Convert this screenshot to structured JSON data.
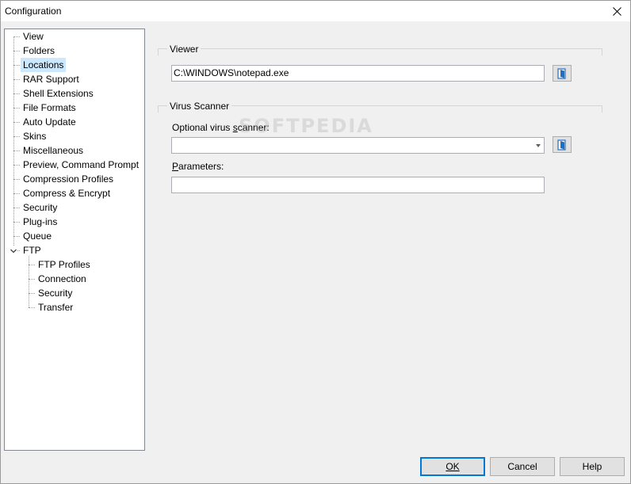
{
  "window": {
    "title": "Configuration"
  },
  "tree": {
    "items": [
      {
        "label": "View",
        "level": 0
      },
      {
        "label": "Folders",
        "level": 0
      },
      {
        "label": "Locations",
        "level": 0,
        "selected": true
      },
      {
        "label": "RAR Support",
        "level": 0
      },
      {
        "label": "Shell Extensions",
        "level": 0
      },
      {
        "label": "File Formats",
        "level": 0
      },
      {
        "label": "Auto Update",
        "level": 0
      },
      {
        "label": "Skins",
        "level": 0
      },
      {
        "label": "Miscellaneous",
        "level": 0
      },
      {
        "label": "Preview, Command Prompt",
        "level": 0
      },
      {
        "label": "Compression Profiles",
        "level": 0
      },
      {
        "label": "Compress & Encrypt",
        "level": 0
      },
      {
        "label": "Security",
        "level": 0
      },
      {
        "label": "Plug-ins",
        "level": 0
      },
      {
        "label": "Queue",
        "level": 0
      },
      {
        "label": "FTP",
        "level": 0,
        "expanded": true
      },
      {
        "label": "FTP Profiles",
        "level": 1
      },
      {
        "label": "Connection",
        "level": 1
      },
      {
        "label": "Security",
        "level": 1
      },
      {
        "label": "Transfer",
        "level": 1
      }
    ]
  },
  "viewer": {
    "group_title": "Viewer",
    "path_value": "C:\\WINDOWS\\notepad.exe"
  },
  "virus_scanner": {
    "group_title": "Virus Scanner",
    "scanner_label_pre": "Optional virus ",
    "scanner_label_accel": "s",
    "scanner_label_post": "canner:",
    "scanner_value": "",
    "params_label_accel": "P",
    "params_label_post": "arameters:",
    "params_value": ""
  },
  "watermark": "SOFTPEDIA",
  "buttons": {
    "ok": "OK",
    "cancel": "Cancel",
    "help": "Help"
  },
  "colors": {
    "selection": "#cce8ff",
    "default_button_border": "#0078d7"
  }
}
